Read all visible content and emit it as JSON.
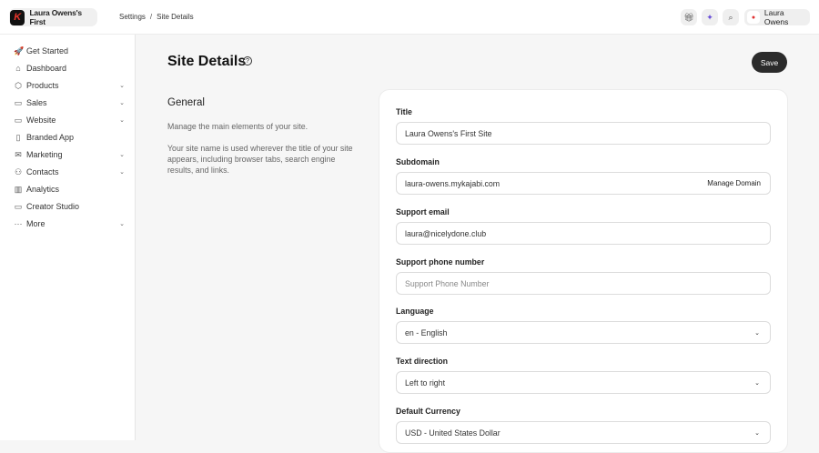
{
  "header": {
    "brand": "Laura Owens's First",
    "breadcrumb": [
      "Settings",
      "Site Details"
    ],
    "user": "Laura Owens"
  },
  "sidebar": {
    "items": [
      {
        "label": "Get Started",
        "icon": "rocket-icon",
        "g": "🚀",
        "chev": false
      },
      {
        "label": "Dashboard",
        "icon": "home-icon",
        "g": "⌂",
        "chev": false
      },
      {
        "label": "Products",
        "icon": "box-icon",
        "g": "⬡",
        "chev": true
      },
      {
        "label": "Sales",
        "icon": "card-icon",
        "g": "▭",
        "chev": true
      },
      {
        "label": "Website",
        "icon": "monitor-icon",
        "g": "▭",
        "chev": true
      },
      {
        "label": "Branded App",
        "icon": "phone-icon",
        "g": "▯",
        "chev": false
      },
      {
        "label": "Marketing",
        "icon": "mail-icon",
        "g": "✉",
        "chev": true
      },
      {
        "label": "Contacts",
        "icon": "users-icon",
        "g": "⚇",
        "chev": true
      },
      {
        "label": "Analytics",
        "icon": "chart-icon",
        "g": "▥",
        "chev": false
      },
      {
        "label": "Creator Studio",
        "icon": "studio-icon",
        "g": "▭",
        "chev": false
      },
      {
        "label": "More",
        "icon": "more-icon",
        "g": "···",
        "chev": true
      }
    ]
  },
  "page": {
    "title": "Site Details",
    "save": "Save",
    "section": "General",
    "desc1": "Manage the main elements of your site.",
    "desc2": "Your site name is used wherever the title of your site appears, including browser tabs, search engine results, and links."
  },
  "form": {
    "title_label": "Title",
    "title_value": "Laura Owens's First Site",
    "subdomain_label": "Subdomain",
    "subdomain_value": "laura-owens.mykajabi.com",
    "manage_domain": "Manage Domain",
    "email_label": "Support email",
    "email_value": "laura@nicelydone.club",
    "phone_label": "Support phone number",
    "phone_placeholder": "Support Phone Number",
    "language_label": "Language",
    "language_value": "en - English",
    "direction_label": "Text direction",
    "direction_value": "Left to right",
    "currency_label": "Default Currency",
    "currency_value": "USD - United States Dollar"
  }
}
